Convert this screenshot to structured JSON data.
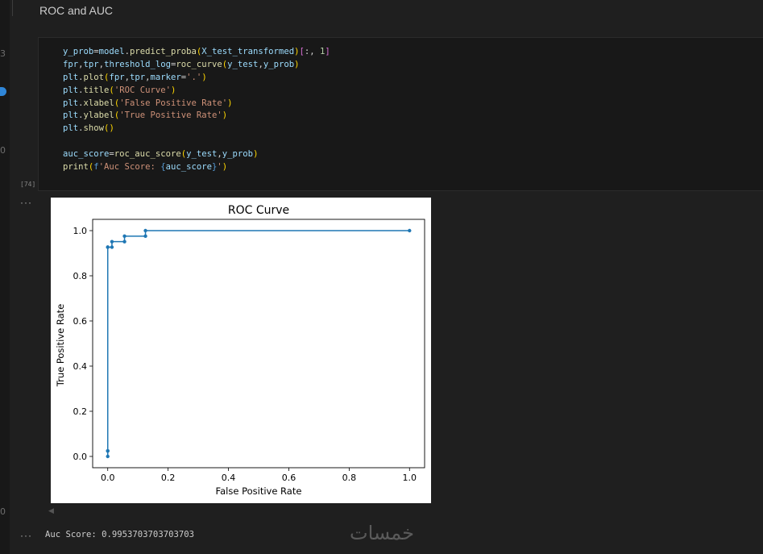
{
  "notebook": {
    "heading": "ROC and AUC",
    "gutter_marks": [
      "3",
      "0",
      "0"
    ],
    "execution_count": "[74]",
    "output_ellipsis": "···",
    "code_lines": [
      [
        [
          "v",
          "y_prob"
        ],
        [
          "p",
          "="
        ],
        [
          "v",
          "model"
        ],
        [
          "p",
          "."
        ],
        [
          "f",
          "predict_proba"
        ],
        [
          "b",
          "("
        ],
        [
          "v",
          "X_test_transformed"
        ],
        [
          "b",
          ")"
        ],
        [
          "b2",
          "["
        ],
        [
          "p",
          ":, "
        ],
        [
          "n",
          "1"
        ],
        [
          "b2",
          "]"
        ]
      ],
      [
        [
          "v",
          "fpr"
        ],
        [
          "p",
          ","
        ],
        [
          "v",
          "tpr"
        ],
        [
          "p",
          ","
        ],
        [
          "v",
          "threshold_log"
        ],
        [
          "p",
          "="
        ],
        [
          "f",
          "roc_curve"
        ],
        [
          "b",
          "("
        ],
        [
          "v",
          "y_test"
        ],
        [
          "p",
          ","
        ],
        [
          "v",
          "y_prob"
        ],
        [
          "b",
          ")"
        ]
      ],
      [
        [
          "v",
          "plt"
        ],
        [
          "p",
          "."
        ],
        [
          "f",
          "plot"
        ],
        [
          "b",
          "("
        ],
        [
          "v",
          "fpr"
        ],
        [
          "p",
          ","
        ],
        [
          "v",
          "tpr"
        ],
        [
          "p",
          ","
        ],
        [
          "v",
          "marker"
        ],
        [
          "p",
          "="
        ],
        [
          "s",
          "'.'"
        ],
        [
          "b",
          ")"
        ]
      ],
      [
        [
          "v",
          "plt"
        ],
        [
          "p",
          "."
        ],
        [
          "f",
          "title"
        ],
        [
          "b",
          "("
        ],
        [
          "s",
          "'ROC Curve'"
        ],
        [
          "b",
          ")"
        ]
      ],
      [
        [
          "v",
          "plt"
        ],
        [
          "p",
          "."
        ],
        [
          "f",
          "xlabel"
        ],
        [
          "b",
          "("
        ],
        [
          "s",
          "'False Positive Rate'"
        ],
        [
          "b",
          ")"
        ]
      ],
      [
        [
          "v",
          "plt"
        ],
        [
          "p",
          "."
        ],
        [
          "f",
          "ylabel"
        ],
        [
          "b",
          "("
        ],
        [
          "s",
          "'True Positive Rate'"
        ],
        [
          "b",
          ")"
        ]
      ],
      [
        [
          "v",
          "plt"
        ],
        [
          "p",
          "."
        ],
        [
          "f",
          "show"
        ],
        [
          "b",
          "("
        ],
        [
          "b",
          ")"
        ]
      ],
      [],
      [
        [
          "v",
          "auc_score"
        ],
        [
          "p",
          "="
        ],
        [
          "f",
          "roc_auc_score"
        ],
        [
          "b",
          "("
        ],
        [
          "v",
          "y_test"
        ],
        [
          "p",
          ","
        ],
        [
          "v",
          "y_prob"
        ],
        [
          "b",
          ")"
        ]
      ],
      [
        [
          "f",
          "print"
        ],
        [
          "b",
          "("
        ],
        [
          "k",
          "f"
        ],
        [
          "s",
          "'Auc Score: "
        ],
        [
          "k",
          "{"
        ],
        [
          "v",
          "auc_score"
        ],
        [
          "k",
          "}"
        ],
        [
          "s",
          "'"
        ],
        [
          "b",
          ")"
        ]
      ]
    ],
    "output_text": "Auc Score: 0.9953703703703703",
    "watermark": "خمسات"
  },
  "colors": {
    "line": "#1f77b4",
    "background": "#1f1f1f",
    "cell_background": "#181818"
  },
  "chart_data": {
    "type": "line",
    "title": "ROC Curve",
    "xlabel": "False Positive Rate",
    "ylabel": "True Positive Rate",
    "xlim": [
      -0.05,
      1.05
    ],
    "ylim": [
      -0.05,
      1.05
    ],
    "xticks": [
      "0.0",
      "0.2",
      "0.4",
      "0.6",
      "0.8",
      "1.0"
    ],
    "yticks": [
      "0.0",
      "0.2",
      "0.4",
      "0.6",
      "0.8",
      "1.0"
    ],
    "grid": false,
    "marker": ".",
    "series": [
      {
        "x": [
          0.0,
          0.0,
          0.0,
          0.0,
          0.0,
          0.0139,
          0.0139,
          0.0556,
          0.0556,
          0.125,
          0.125,
          1.0
        ],
        "y": [
          0.0,
          0.0244,
          0.0244,
          0.9268,
          0.9268,
          0.9268,
          0.9512,
          0.9512,
          0.9756,
          0.9756,
          1.0,
          1.0
        ]
      }
    ]
  }
}
